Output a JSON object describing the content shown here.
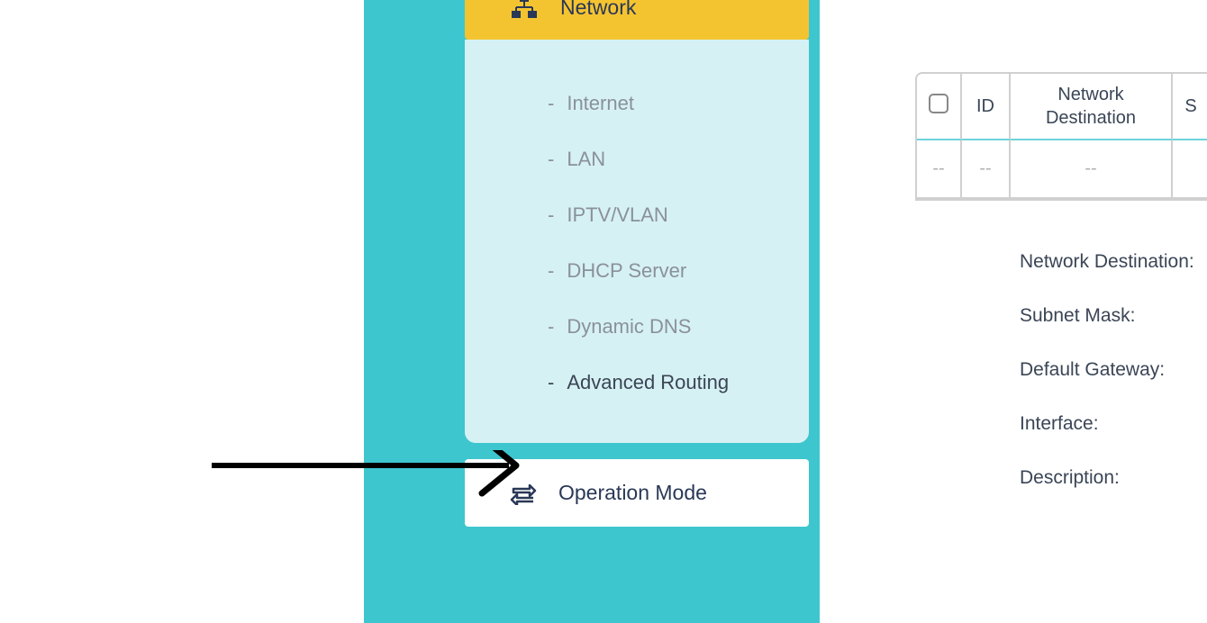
{
  "sidebar": {
    "network_label": "Network",
    "items": [
      {
        "label": "Internet"
      },
      {
        "label": "LAN"
      },
      {
        "label": "IPTV/VLAN"
      },
      {
        "label": "DHCP Server"
      },
      {
        "label": "Dynamic DNS"
      },
      {
        "label": "Advanced Routing"
      }
    ],
    "operation_mode_label": "Operation Mode"
  },
  "table": {
    "columns": {
      "id": "ID",
      "network_destination": "Network Destination",
      "partial": "S"
    },
    "empty_row": {
      "checkbox": "--",
      "id": "--",
      "dest": "--"
    }
  },
  "form": {
    "network_destination": "Network Destination:",
    "subnet_mask": "Subnet Mask:",
    "default_gateway": "Default Gateway:",
    "interface": "Interface:",
    "description": "Description:"
  }
}
